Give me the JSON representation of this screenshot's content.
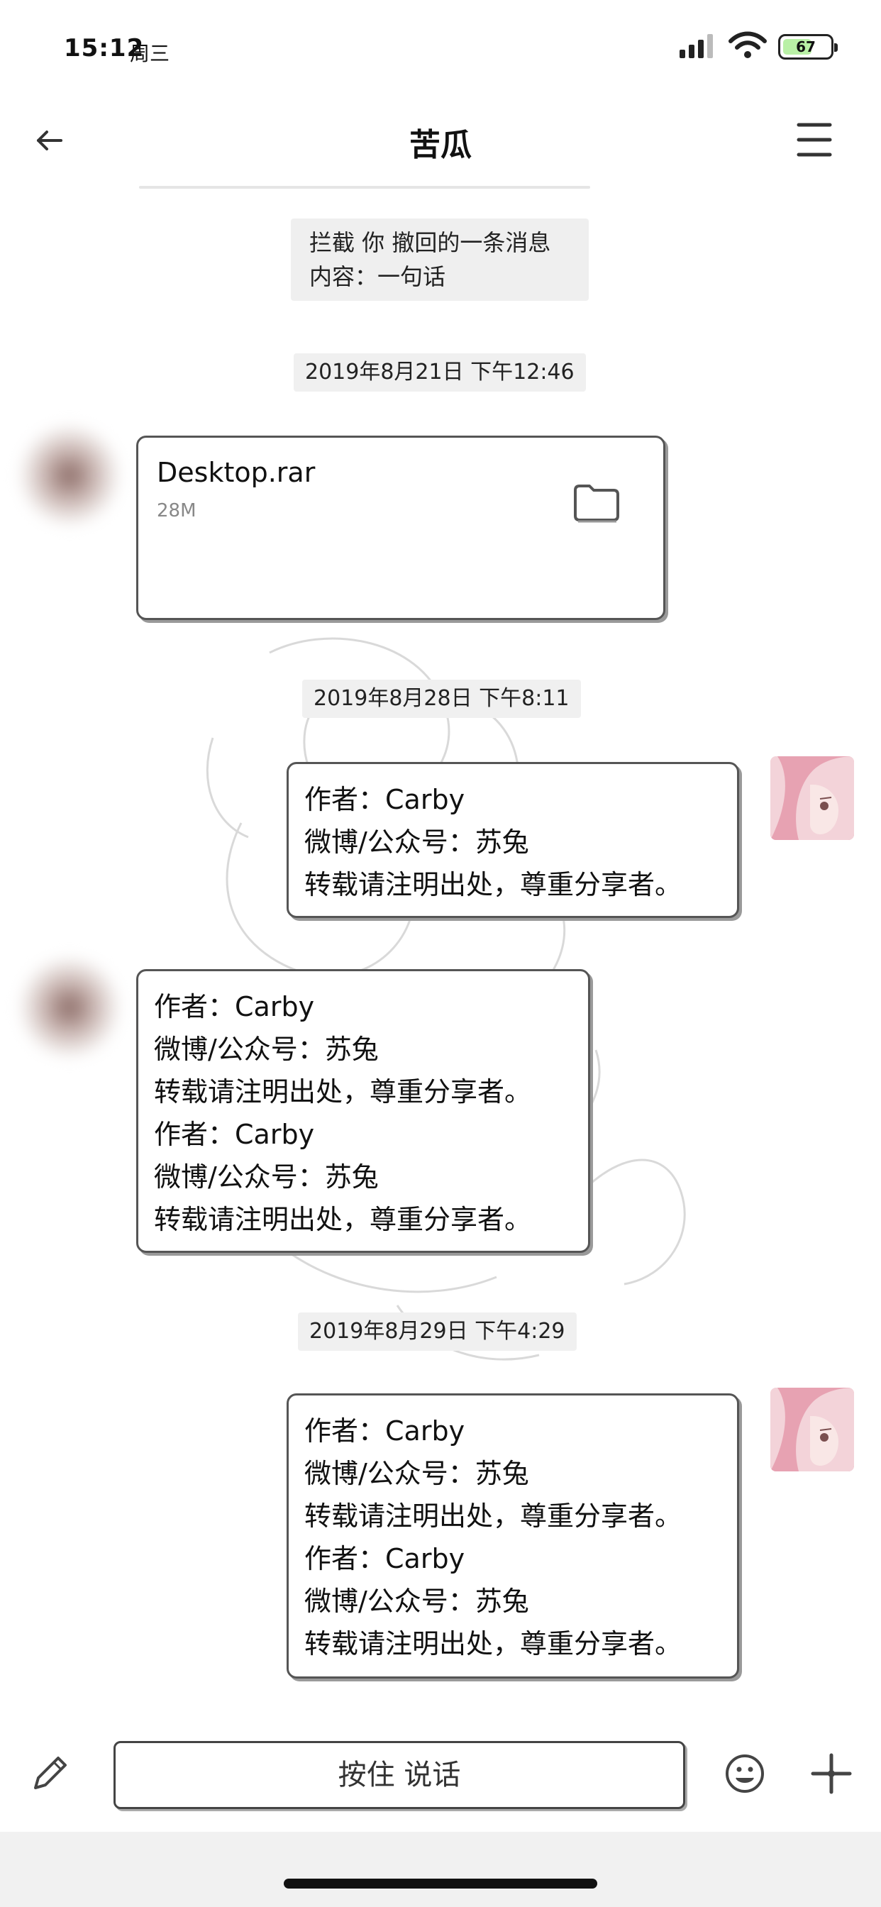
{
  "status_bar": {
    "time": "15:12",
    "day": "周三",
    "battery_level": "67",
    "battery_fraction": 0.67
  },
  "header": {
    "title": "苦瓜"
  },
  "chat": {
    "recall_notice": {
      "line1": "拦截 你 撤回的一条消息",
      "line2": "内容：一句话"
    },
    "timestamps": [
      "2019年8月21日 下午12:46",
      "2019年8月28日 下午8:11",
      "2019年8月29日 下午4:29"
    ],
    "file_message": {
      "name": "Desktop.rar",
      "size": "28M",
      "icon": "folder-icon"
    },
    "messages": [
      {
        "side": "right",
        "lines": [
          "作者：Carby",
          "微博/公众号：苏兔",
          "转载请注明出处，尊重分享者。"
        ]
      },
      {
        "side": "left",
        "lines": [
          "作者：Carby",
          "微博/公众号：苏兔",
          "转载请注明出处，尊重分享者。",
          "作者：Carby",
          "微博/公众号：苏兔",
          "转载请注明出处，尊重分享者。"
        ]
      },
      {
        "side": "right",
        "lines": [
          "作者：Carby",
          "微博/公众号：苏兔",
          "转载请注明出处，尊重分享者。",
          "作者：Carby",
          "微博/公众号：苏兔",
          "转载请注明出处，尊重分享者。"
        ]
      }
    ]
  },
  "input_bar": {
    "voice_button_label": "按住 说话",
    "icons": [
      "pencil-icon",
      "emoji-icon",
      "plus-icon"
    ]
  },
  "colors": {
    "bubble_border": "#555555",
    "battery_fill": "#b9f0a6",
    "timestamp_bg": "#f0f0f0"
  }
}
